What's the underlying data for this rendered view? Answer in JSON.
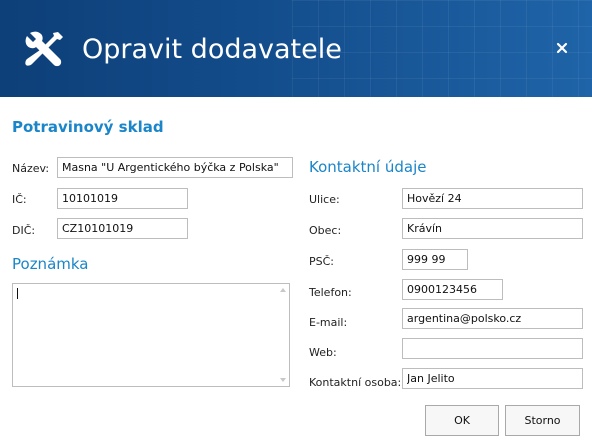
{
  "dialog": {
    "title": "Opravit dodavatele",
    "company_name": "Potravinový sklad",
    "header_color": "#134d8c",
    "accent_color": "#1a85c8",
    "icon": "tools-icon",
    "close_icon": "close-icon"
  },
  "basic": {
    "name": {
      "label": "Název:",
      "value": "Masna \"U Argentického býčka z Polska\""
    },
    "ic": {
      "label": "IČ:",
      "value": "10101019"
    },
    "dic": {
      "label": "DIČ:",
      "value": "CZ10101019"
    }
  },
  "note": {
    "heading": "Poznámka",
    "value": ""
  },
  "contact": {
    "heading": "Kontaktní údaje",
    "street": {
      "label": "Ulice:",
      "value": "Hovězí 24"
    },
    "city": {
      "label": "Obec:",
      "value": "Krávín"
    },
    "zip": {
      "label": "PSČ:",
      "value": "999 99"
    },
    "phone": {
      "label": "Telefon:",
      "value": "0900123456"
    },
    "email": {
      "label": "E-mail:",
      "value": "argentina@polsko.cz"
    },
    "web": {
      "label": "Web:",
      "value": ""
    },
    "person": {
      "label": "Kontaktní osoba:",
      "value": "Jan Jelito"
    }
  },
  "buttons": {
    "ok": "OK",
    "cancel": "Storno"
  }
}
